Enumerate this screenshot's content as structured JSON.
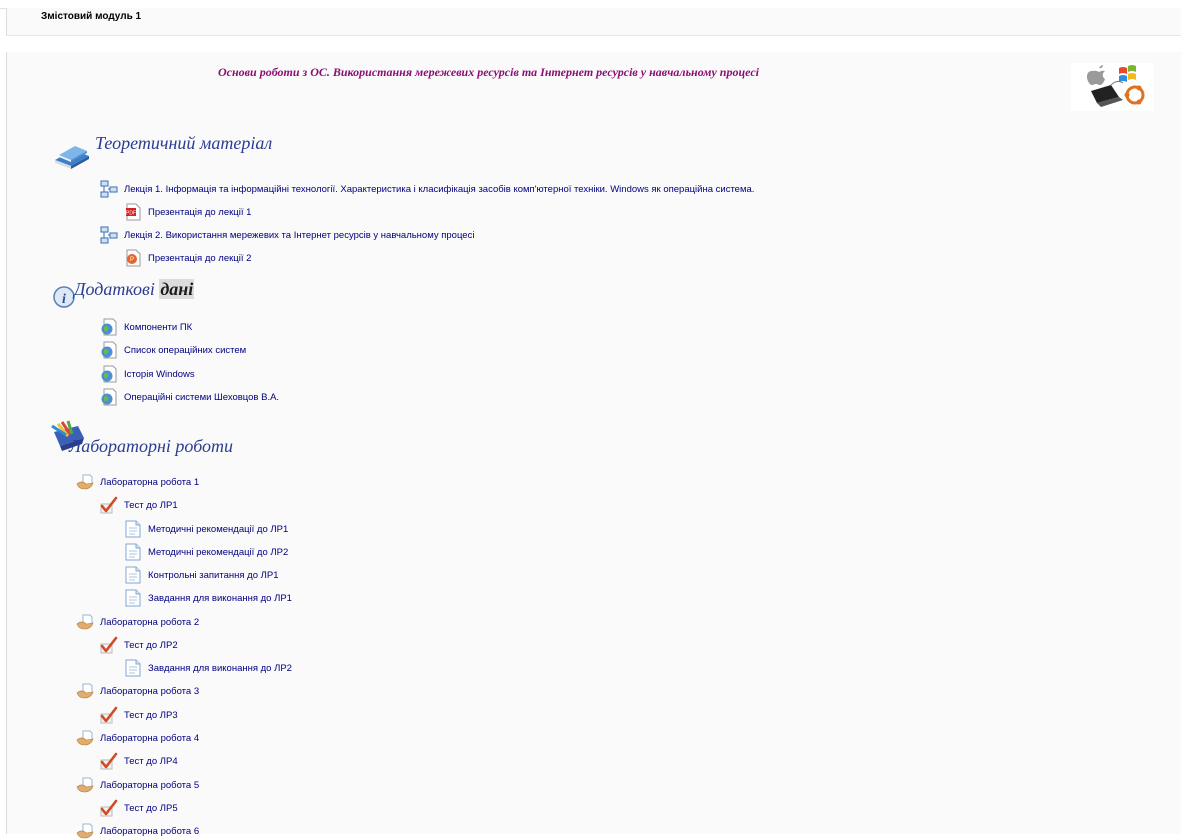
{
  "section": {
    "title": "Змістовий модуль 1"
  },
  "banner": {
    "title": "Основи роботи з ОС. Використання мережевих ресурсів та Інтернет ресурсів у навчальному процесі"
  },
  "theory": {
    "heading": "Теоретичний матеріал",
    "items": [
      {
        "label": "Лекція 1. Інформація та інформаційні технології. Характеристика і класифікація засобів комп'ютерної техніки. Windows як операційна система.",
        "icon": "page-structure-icon"
      },
      {
        "label": "Презентація до лекції 1",
        "icon": "pdf-icon"
      },
      {
        "label": "Лекція 2. Використання мережевих та Інтернет ресурсів у навчальному процесі",
        "icon": "page-structure-icon"
      },
      {
        "label": "Презентація до лекції 2",
        "icon": "powerpoint-icon"
      }
    ]
  },
  "extra": {
    "heading_part1": "Додаткові",
    "heading_part2": "дані",
    "items": [
      {
        "label": "Компоненти ПК",
        "icon": "web-link-icon"
      },
      {
        "label": "Список операційних систем",
        "icon": "web-link-icon"
      },
      {
        "label": "Історія Windows",
        "icon": "web-link-icon"
      },
      {
        "label": "Операційні системи Шеховцов В.А.",
        "icon": "web-link-icon"
      }
    ]
  },
  "labs": {
    "heading": "Лабораторні роботи",
    "items": [
      {
        "label": "Лабораторна робота 1",
        "icon": "assignment-icon"
      },
      {
        "label": "Тест до ЛР1",
        "icon": "quiz-icon"
      },
      {
        "label": "Методичні рекомендації до ЛР1",
        "icon": "page-icon"
      },
      {
        "label": "Методичні рекомендації до ЛР2",
        "icon": "page-icon"
      },
      {
        "label": "Контрольні запитання до ЛР1",
        "icon": "page-icon"
      },
      {
        "label": "Завдання для виконання до ЛР1",
        "icon": "page-icon"
      },
      {
        "label": "Лабораторна робота 2",
        "icon": "assignment-icon"
      },
      {
        "label": "Тест до ЛР2",
        "icon": "quiz-icon"
      },
      {
        "label": "Завдання для виконання до ЛР2",
        "icon": "page-icon"
      },
      {
        "label": "Лабораторна робота 3",
        "icon": "assignment-icon"
      },
      {
        "label": "Тест до ЛР3",
        "icon": "quiz-icon"
      },
      {
        "label": "Лабораторна робота 4",
        "icon": "assignment-icon"
      },
      {
        "label": "Тест до ЛР4",
        "icon": "quiz-icon"
      },
      {
        "label": "Лабораторна робота 5",
        "icon": "assignment-icon"
      },
      {
        "label": "Тест до ЛР5",
        "icon": "quiz-icon"
      },
      {
        "label": "Лабораторна робота 6",
        "icon": "assignment-icon"
      }
    ]
  }
}
